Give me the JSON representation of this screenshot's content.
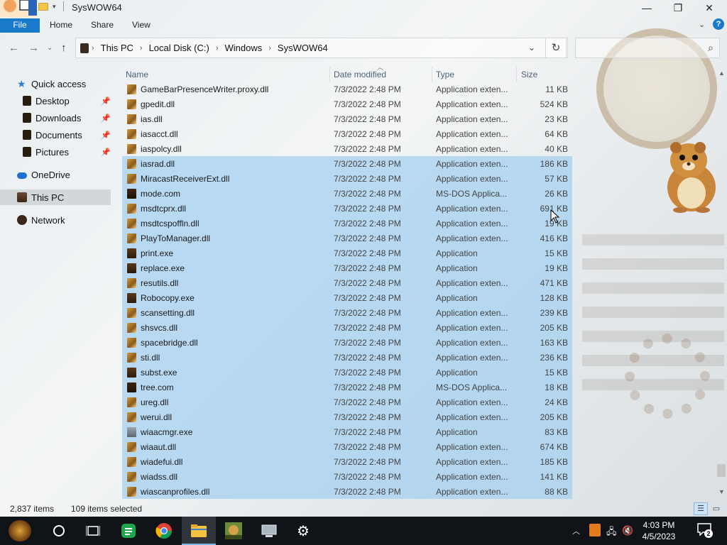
{
  "window": {
    "title": "SysWOW64",
    "controls": {
      "minimize": "—",
      "maximize": "❐",
      "close": "✕"
    }
  },
  "ribbon": {
    "tabs": [
      "File",
      "Home",
      "Share",
      "View"
    ],
    "help": "?"
  },
  "address": {
    "crumbs": [
      "This PC",
      "Local Disk (C:)",
      "Windows",
      "SysWOW64"
    ],
    "search_placeholder": ""
  },
  "nav": {
    "items": [
      {
        "label": "Quick access",
        "icon": "star-icon",
        "pinned": false
      },
      {
        "label": "Desktop",
        "icon": "folder-icon",
        "pinned": true
      },
      {
        "label": "Downloads",
        "icon": "folder-icon",
        "pinned": true
      },
      {
        "label": "Documents",
        "icon": "folder-icon",
        "pinned": true
      },
      {
        "label": "Pictures",
        "icon": "folder-icon",
        "pinned": true
      },
      {
        "label": "OneDrive",
        "icon": "cloud-icon",
        "pinned": false
      },
      {
        "label": "This PC",
        "icon": "computer-icon",
        "pinned": false,
        "selected": true
      },
      {
        "label": "Network",
        "icon": "network-icon",
        "pinned": false
      }
    ]
  },
  "columns": {
    "name": "Name",
    "date": "Date modified",
    "type": "Type",
    "size": "Size"
  },
  "files": [
    {
      "name": "GameBarPresenceWriter.proxy.dll",
      "date": "7/3/2022 2:48 PM",
      "type": "Application exten...",
      "size": "11 KB",
      "icon": "dll",
      "selected": false
    },
    {
      "name": "gpedit.dll",
      "date": "7/3/2022 2:48 PM",
      "type": "Application exten...",
      "size": "524 KB",
      "icon": "dll",
      "selected": false
    },
    {
      "name": "ias.dll",
      "date": "7/3/2022 2:48 PM",
      "type": "Application exten...",
      "size": "23 KB",
      "icon": "dll",
      "selected": false
    },
    {
      "name": "iasacct.dll",
      "date": "7/3/2022 2:48 PM",
      "type": "Application exten...",
      "size": "64 KB",
      "icon": "dll",
      "selected": false
    },
    {
      "name": "iaspolcy.dll",
      "date": "7/3/2022 2:48 PM",
      "type": "Application exten...",
      "size": "40 KB",
      "icon": "dll",
      "selected": false
    },
    {
      "name": "iasrad.dll",
      "date": "7/3/2022 2:48 PM",
      "type": "Application exten...",
      "size": "186 KB",
      "icon": "dll",
      "selected": true
    },
    {
      "name": "MiracastReceiverExt.dll",
      "date": "7/3/2022 2:48 PM",
      "type": "Application exten...",
      "size": "57 KB",
      "icon": "dll",
      "selected": true
    },
    {
      "name": "mode.com",
      "date": "7/3/2022 2:48 PM",
      "type": "MS-DOS Applica...",
      "size": "26 KB",
      "icon": "com",
      "selected": true
    },
    {
      "name": "msdtcprx.dll",
      "date": "7/3/2022 2:48 PM",
      "type": "Application exten...",
      "size": "691 KB",
      "icon": "dll",
      "selected": true
    },
    {
      "name": "msdtcspoffln.dll",
      "date": "7/3/2022 2:48 PM",
      "type": "Application exten...",
      "size": "19 KB",
      "icon": "dll",
      "selected": true
    },
    {
      "name": "PlayToManager.dll",
      "date": "7/3/2022 2:48 PM",
      "type": "Application exten...",
      "size": "416 KB",
      "icon": "dll",
      "selected": true
    },
    {
      "name": "print.exe",
      "date": "7/3/2022 2:48 PM",
      "type": "Application",
      "size": "15 KB",
      "icon": "exe",
      "selected": true
    },
    {
      "name": "replace.exe",
      "date": "7/3/2022 2:48 PM",
      "type": "Application",
      "size": "19 KB",
      "icon": "exe",
      "selected": true
    },
    {
      "name": "resutils.dll",
      "date": "7/3/2022 2:48 PM",
      "type": "Application exten...",
      "size": "471 KB",
      "icon": "dll",
      "selected": true
    },
    {
      "name": "Robocopy.exe",
      "date": "7/3/2022 2:48 PM",
      "type": "Application",
      "size": "128 KB",
      "icon": "exe",
      "selected": true
    },
    {
      "name": "scansetting.dll",
      "date": "7/3/2022 2:48 PM",
      "type": "Application exten...",
      "size": "239 KB",
      "icon": "dll",
      "selected": true
    },
    {
      "name": "shsvcs.dll",
      "date": "7/3/2022 2:48 PM",
      "type": "Application exten...",
      "size": "205 KB",
      "icon": "dll",
      "selected": true
    },
    {
      "name": "spacebridge.dll",
      "date": "7/3/2022 2:48 PM",
      "type": "Application exten...",
      "size": "163 KB",
      "icon": "dll",
      "selected": true
    },
    {
      "name": "sti.dll",
      "date": "7/3/2022 2:48 PM",
      "type": "Application exten...",
      "size": "236 KB",
      "icon": "dll",
      "selected": true
    },
    {
      "name": "subst.exe",
      "date": "7/3/2022 2:48 PM",
      "type": "Application",
      "size": "15 KB",
      "icon": "exe",
      "selected": true
    },
    {
      "name": "tree.com",
      "date": "7/3/2022 2:48 PM",
      "type": "MS-DOS Applica...",
      "size": "18 KB",
      "icon": "com",
      "selected": true
    },
    {
      "name": "ureg.dll",
      "date": "7/3/2022 2:48 PM",
      "type": "Application exten...",
      "size": "24 KB",
      "icon": "dll",
      "selected": true
    },
    {
      "name": "werui.dll",
      "date": "7/3/2022 2:48 PM",
      "type": "Application exten...",
      "size": "205 KB",
      "icon": "dll",
      "selected": true
    },
    {
      "name": "wiaacmgr.exe",
      "date": "7/3/2022 2:48 PM",
      "type": "Application",
      "size": "83 KB",
      "icon": "wia",
      "selected": true
    },
    {
      "name": "wiaaut.dll",
      "date": "7/3/2022 2:48 PM",
      "type": "Application exten...",
      "size": "674 KB",
      "icon": "dll",
      "selected": true
    },
    {
      "name": "wiadefui.dll",
      "date": "7/3/2022 2:48 PM",
      "type": "Application exten...",
      "size": "185 KB",
      "icon": "dll",
      "selected": true
    },
    {
      "name": "wiadss.dll",
      "date": "7/3/2022 2:48 PM",
      "type": "Application exten...",
      "size": "141 KB",
      "icon": "dll",
      "selected": true
    },
    {
      "name": "wiascanprofiles.dll",
      "date": "7/3/2022 2:48 PM",
      "type": "Application exten...",
      "size": "88 KB",
      "icon": "dll",
      "selected": true
    }
  ],
  "status": {
    "count": "2,837 items",
    "selected": "109 items selected"
  },
  "taskbar": {
    "time": "4:03 PM",
    "date": "4/5/2023",
    "notifications": "2"
  },
  "colors": {
    "accent": "#1979ca",
    "selection": "#a2cef1",
    "taskbar": "#101418"
  }
}
